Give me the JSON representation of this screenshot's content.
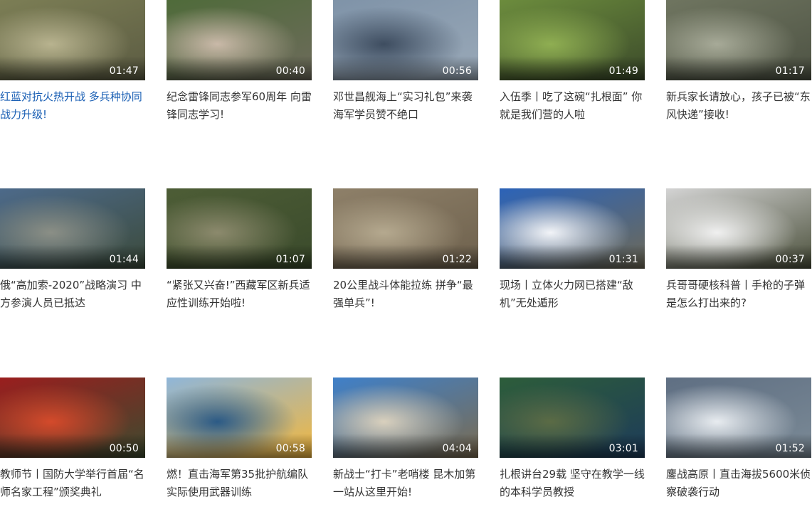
{
  "videos": [
    {
      "title": "红蓝对抗火热开战 多兵种协同战力升级!",
      "duration": "01:47",
      "colors": [
        "#7c7e55",
        "#b8b38f",
        "#5b5b42"
      ]
    },
    {
      "title": "纪念雷锋同志参军60周年 向雷锋同志学习!",
      "duration": "00:40",
      "colors": [
        "#4f6b3a",
        "#c9b9a8",
        "#6e6b5c"
      ]
    },
    {
      "title": "邓世昌舰海上“实习礼包”来袭 海军学员赞不绝口",
      "duration": "00:56",
      "colors": [
        "#7f93a8",
        "#3e4d60",
        "#9aa9b8"
      ]
    },
    {
      "title": "入伍季丨吃了这碗“扎根面” 你就是我们营的人啦",
      "duration": "01:49",
      "colors": [
        "#6c8c3d",
        "#8fae52",
        "#3b4a2a"
      ]
    },
    {
      "title": "新兵家长请放心，孩子已被“东风快递”接收!",
      "duration": "01:17",
      "colors": [
        "#6f7560",
        "#a7aa98",
        "#4d5243"
      ]
    },
    {
      "title": "俄“高加索-2020”战略演习 中方参演人员已抵达",
      "duration": "01:44",
      "colors": [
        "#4d6a8a",
        "#8b8f86",
        "#3b4a3a"
      ]
    },
    {
      "title": "“紧张又兴奋!”西藏军区新兵适应性训练开始啦!",
      "duration": "01:07",
      "colors": [
        "#4d5d36",
        "#8c8a6d",
        "#3a4a2b"
      ]
    },
    {
      "title": "20公里战斗体能拉练 拼争“最强单兵”!",
      "duration": "01:22",
      "colors": [
        "#8e8069",
        "#b5a98f",
        "#6d604c"
      ]
    },
    {
      "title": "现场丨立体火力网已搭建“敌机”无处遁形",
      "duration": "01:31",
      "colors": [
        "#2c63b8",
        "#f2f4f8",
        "#6f6a56"
      ]
    },
    {
      "title": "兵哥哥硬核科普丨手枪的子弹是怎么打出来的?",
      "duration": "00:37",
      "colors": [
        "#d4d4d4",
        "#f0f0f0",
        "#4a4f3a"
      ]
    },
    {
      "title": "教师节丨国防大学举行首届“名师名家工程”颁奖典礼",
      "duration": "00:50",
      "colors": [
        "#9a1e1e",
        "#d44a2b",
        "#3c4b2f"
      ]
    },
    {
      "title": "燃！直击海军第35批护航编队实际使用武器训练",
      "duration": "00:58",
      "colors": [
        "#8fb6d9",
        "#2b5a86",
        "#f3b73c"
      ]
    },
    {
      "title": "新战士“打卡”老哨楼 昆木加第一站从这里开始!",
      "duration": "04:04",
      "colors": [
        "#3f80c9",
        "#d9d0bd",
        "#7b6b4f"
      ]
    },
    {
      "title": "扎根讲台29载 坚守在教学一线的本科学员教授",
      "duration": "03:01",
      "colors": [
        "#2d5d3a",
        "#5b6b45",
        "#1d3b5a"
      ]
    },
    {
      "title": "鏖战高原丨直击海拔5600米侦察破袭行动",
      "duration": "01:52",
      "colors": [
        "#5f6f83",
        "#e8ecf0",
        "#7b8a96"
      ]
    }
  ]
}
